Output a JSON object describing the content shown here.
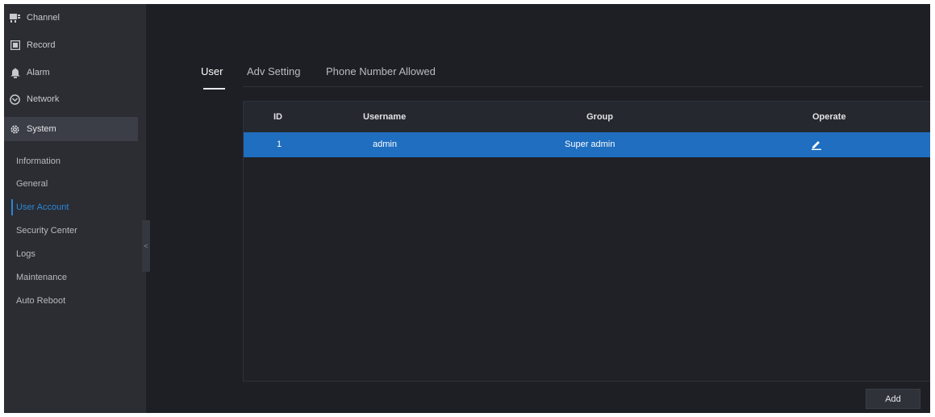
{
  "sidebar": {
    "nav": [
      {
        "label": "Channel",
        "icon": "channel-icon"
      },
      {
        "label": "Record",
        "icon": "record-icon"
      },
      {
        "label": "Alarm",
        "icon": "alarm-icon"
      },
      {
        "label": "Network",
        "icon": "network-icon"
      },
      {
        "label": "System",
        "icon": "gear-icon",
        "selected": true
      }
    ],
    "system_items": [
      {
        "label": "Information"
      },
      {
        "label": "General"
      },
      {
        "label": "User Account",
        "active": true
      },
      {
        "label": "Security Center"
      },
      {
        "label": "Logs"
      },
      {
        "label": "Maintenance"
      },
      {
        "label": "Auto Reboot"
      }
    ],
    "collapse_glyph": "<"
  },
  "tabs": [
    {
      "label": "User",
      "active": true
    },
    {
      "label": "Adv Setting"
    },
    {
      "label": "Phone Number Allowed"
    }
  ],
  "table": {
    "columns": [
      "ID",
      "Username",
      "Group",
      "Operate"
    ],
    "rows": [
      {
        "id": "1",
        "username": "admin",
        "group": "Super admin",
        "operate_icon": "edit-icon",
        "selected": true
      }
    ]
  },
  "actions": {
    "add_label": "Add"
  },
  "colors": {
    "background": "#1d1f25",
    "sidebar": "#2b2d33",
    "accent": "#2c86d8",
    "row_selected": "#1f6ec0"
  }
}
